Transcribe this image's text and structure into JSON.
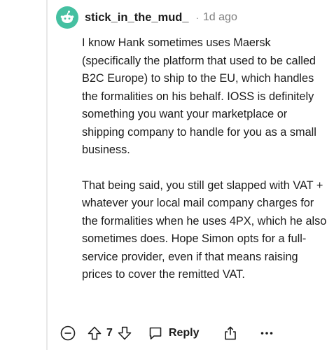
{
  "comment": {
    "username": "stick_in_the_mud_",
    "separator": "·",
    "age": "1d ago",
    "paragraphs": [
      "I know Hank sometimes uses Maersk (specifically the platform that used to be called B2C Europe) to ship to the EU, which handles the formalities on his behalf. IOSS is definitely something you want your marketplace or shipping company to handle for you as a small business.",
      "That being said, you still get slapped with VAT + whatever your local mail company charges for the formalities when he uses 4PX, which he also sometimes does. Hope Simon opts for a full-service provider, even if that means raising prices to cover the remitted VAT."
    ]
  },
  "actions": {
    "collapse_icon": "minus-circle-icon",
    "upvote_icon": "arrow-up-icon",
    "vote_count": "7",
    "downvote_icon": "arrow-down-icon",
    "reply_icon": "speech-bubble-icon",
    "reply_label": "Reply",
    "share_icon": "share-icon",
    "more_icon": "ellipsis-icon"
  },
  "colors": {
    "avatar_bg": "#45c0a1",
    "text": "#1c1c1c",
    "muted": "#7c7c7c",
    "thread_line": "#e8e8e8"
  }
}
